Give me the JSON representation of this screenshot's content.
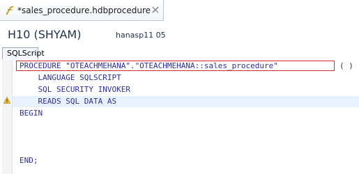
{
  "editor_tab": {
    "title": "*sales_procedure.hdbprocedure",
    "icon": "procedure-file-icon",
    "close_icon": "close-icon"
  },
  "header": {
    "system_name": "H10 (SHYAM)",
    "host": "hanasp11 05"
  },
  "subtabs": [
    {
      "label": "SQLScript"
    }
  ],
  "code": {
    "lines": [
      "PROCEDURE \"OTEACHMEHANA\".\"OTEACHMEHANA::sales_procedure\"",
      "    LANGUAGE SQLSCRIPT",
      "    SQL SECURITY INVOKER",
      "    READS SQL DATA AS",
      "BEGIN",
      "",
      "",
      "",
      "END;"
    ],
    "paren_suffix": "( )",
    "highlight_color": "#d42b2b",
    "current_line_color": "#e8f2fe",
    "keyword_color": "#2f2f9e",
    "gutter_marker": "warning-icon"
  }
}
